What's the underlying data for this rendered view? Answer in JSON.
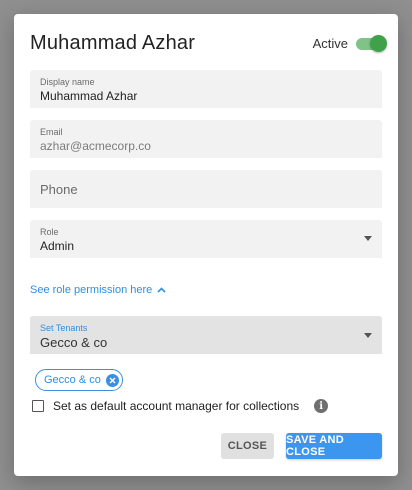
{
  "dialog": {
    "title": "Muhammad Azhar",
    "active_label": "Active",
    "active_on": true
  },
  "fields": {
    "display_name": {
      "label": "Display name",
      "value": "Muhammad Azhar"
    },
    "email": {
      "label": "Email",
      "value": "azhar@acmecorp.co"
    },
    "phone": {
      "placeholder": "Phone"
    },
    "role": {
      "label": "Role",
      "value": "Admin"
    }
  },
  "permissions_link": "See role permission here",
  "tenants": {
    "label": "Set Tenants",
    "value": "Gecco & co",
    "chips": [
      "Gecco & co"
    ]
  },
  "default_manager": {
    "label": "Set as default account manager for collections",
    "checked": false
  },
  "buttons": {
    "close": "CLOSE",
    "save_close": "SAVE AND CLOSE"
  },
  "colors": {
    "accent": "#3c96ef",
    "toggle_on": "#3fa14a",
    "backdrop": "#8f8f8f"
  }
}
